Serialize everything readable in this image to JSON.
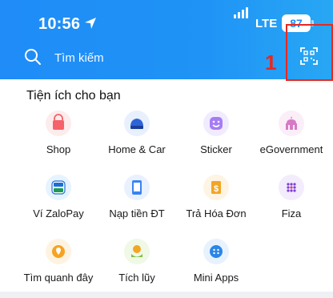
{
  "status_bar": {
    "time": "10:56",
    "network": "LTE",
    "battery": "87"
  },
  "search": {
    "placeholder": "Tìm kiếm"
  },
  "annotation": {
    "number": "1"
  },
  "section": {
    "title": "Tiện ích cho bạn"
  },
  "utilities": [
    {
      "label": "Shop",
      "icon": "shop-bag-icon",
      "color": "#f6626a"
    },
    {
      "label": "Home & Car",
      "icon": "car-icon",
      "color": "#2f64d6"
    },
    {
      "label": "Sticker",
      "icon": "sticker-smile-icon",
      "color": "#a67cf5"
    },
    {
      "label": "eGovernment",
      "icon": "government-building-icon",
      "color": "#d77ac5"
    },
    {
      "label": "Ví ZaloPay",
      "icon": "zalopay-wallet-icon",
      "color": "#1c9a58"
    },
    {
      "label": "Nạp tiền ĐT",
      "icon": "phone-topup-icon",
      "color": "#3a83f2"
    },
    {
      "label": "Trả Hóa Đơn",
      "icon": "bill-payment-icon",
      "color": "#f2a625"
    },
    {
      "label": "Fiza",
      "icon": "fiza-dots-icon",
      "color": "#7b3fd7"
    },
    {
      "label": "Tìm quanh đây",
      "icon": "location-pin-icon",
      "color": "#f6a321"
    },
    {
      "label": "Tích lũy",
      "icon": "savings-coin-icon",
      "color": "#80c043"
    },
    {
      "label": "Mini Apps",
      "icon": "mini-apps-icon",
      "color": "#2a86e8"
    }
  ]
}
